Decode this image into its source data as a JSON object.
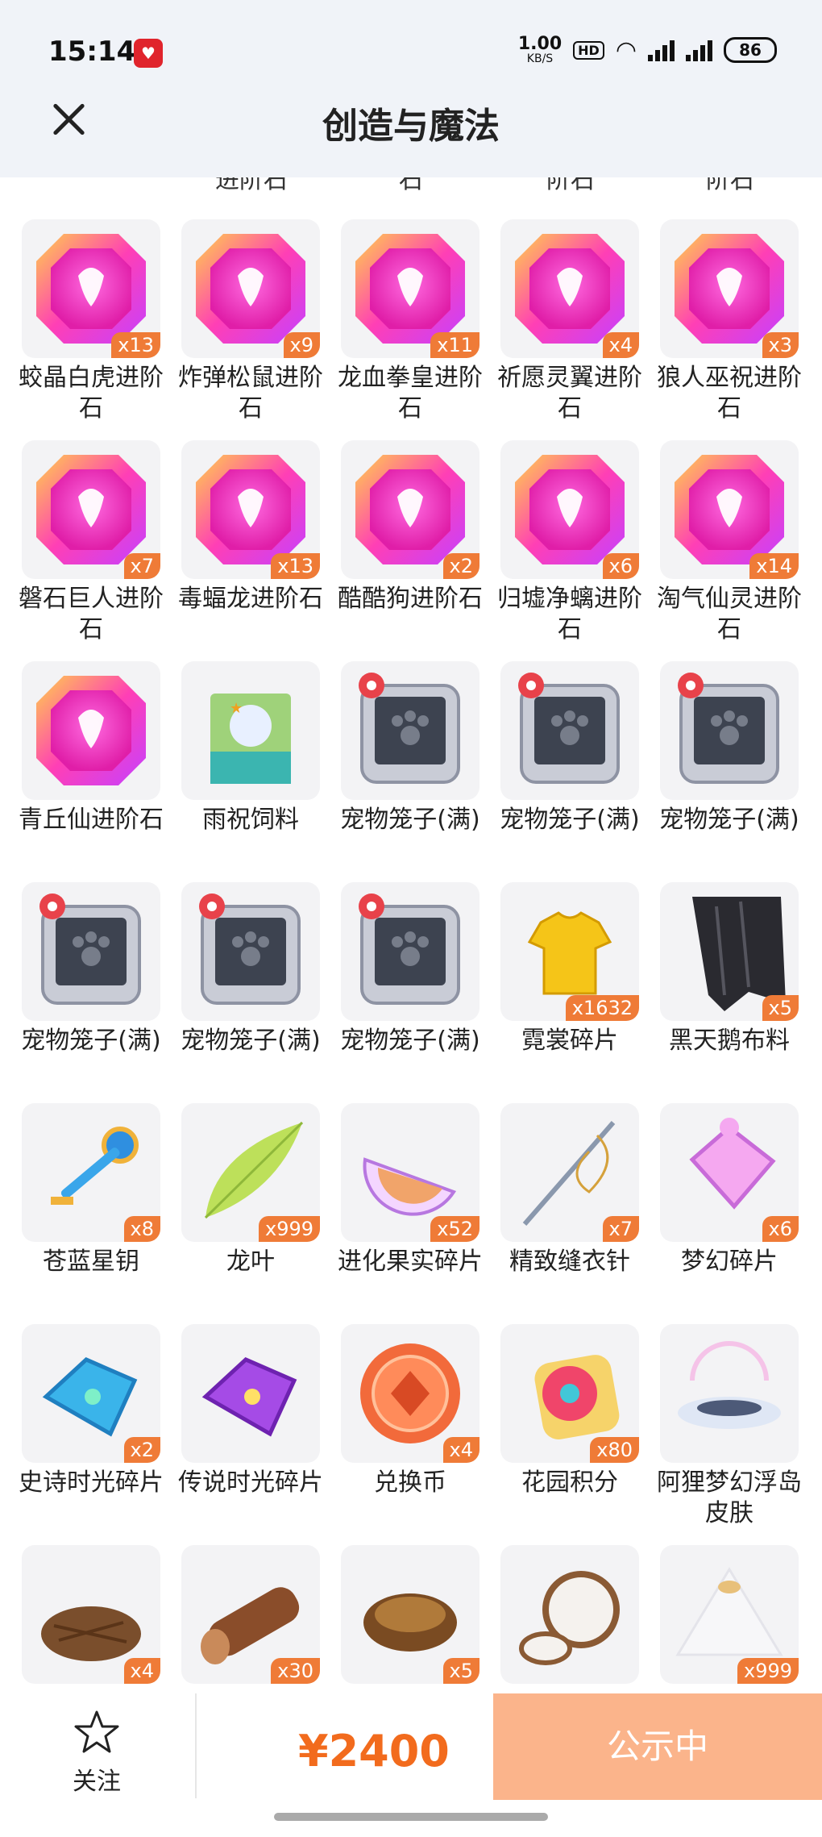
{
  "status_bar": {
    "time": "15:14",
    "net_speed_value": "1.00",
    "net_speed_unit": "KB/S",
    "battery": "86"
  },
  "header": {
    "title": "创造与魔法"
  },
  "prev_row_tail": [
    "进阶石",
    "石",
    "阶石",
    "阶石"
  ],
  "items": [
    {
      "name": "蛟晶白虎进阶石",
      "qty": "x13",
      "icon": "gem-icon"
    },
    {
      "name": "炸弹松鼠进阶石",
      "qty": "x9",
      "icon": "gem-icon"
    },
    {
      "name": "龙血拳皇进阶石",
      "qty": "x11",
      "icon": "gem-icon"
    },
    {
      "name": "祈愿灵翼进阶石",
      "qty": "x4",
      "icon": "gem-icon"
    },
    {
      "name": "狼人巫祝进阶石",
      "qty": "x3",
      "icon": "gem-icon"
    },
    {
      "name": "磐石巨人进阶石",
      "qty": "x7",
      "icon": "gem-icon"
    },
    {
      "name": "毒蝠龙进阶石",
      "qty": "x13",
      "icon": "gem-icon"
    },
    {
      "name": "酷酷狗进阶石",
      "qty": "x2",
      "icon": "gem-icon"
    },
    {
      "name": "归墟净螭进阶石",
      "qty": "x6",
      "icon": "gem-icon"
    },
    {
      "name": "淘气仙灵进阶石",
      "qty": "x14",
      "icon": "gem-icon"
    },
    {
      "name": "青丘仙进阶石",
      "qty": "",
      "icon": "gem-icon"
    },
    {
      "name": "雨祝饲料",
      "qty": "",
      "icon": "feed-bag-icon"
    },
    {
      "name": "宠物笼子(满)",
      "qty": "",
      "icon": "pet-cage-icon"
    },
    {
      "name": "宠物笼子(满)",
      "qty": "",
      "icon": "pet-cage-icon"
    },
    {
      "name": "宠物笼子(满)",
      "qty": "",
      "icon": "pet-cage-icon"
    },
    {
      "name": "宠物笼子(满)",
      "qty": "",
      "icon": "pet-cage-icon"
    },
    {
      "name": "宠物笼子(满)",
      "qty": "",
      "icon": "pet-cage-icon"
    },
    {
      "name": "宠物笼子(满)",
      "qty": "",
      "icon": "pet-cage-icon"
    },
    {
      "name": "霓裳碎片",
      "qty": "x1632",
      "icon": "shirt-icon"
    },
    {
      "name": "黑天鹅布料",
      "qty": "x5",
      "icon": "black-cloth-icon"
    },
    {
      "name": "苍蓝星钥",
      "qty": "x8",
      "icon": "key-icon"
    },
    {
      "name": "龙叶",
      "qty": "x999",
      "icon": "leaf-icon"
    },
    {
      "name": "进化果实碎片",
      "qty": "x52",
      "icon": "fruit-slice-icon"
    },
    {
      "name": "精致缝衣针",
      "qty": "x7",
      "icon": "needle-icon"
    },
    {
      "name": "梦幻碎片",
      "qty": "x6",
      "icon": "puzzle-icon"
    },
    {
      "name": "史诗时光碎片",
      "qty": "x2",
      "icon": "blue-puzzle-icon"
    },
    {
      "name": "传说时光碎片",
      "qty": "",
      "icon": "purple-puzzle-icon"
    },
    {
      "name": "兑换币",
      "qty": "x4",
      "icon": "coin-icon"
    },
    {
      "name": "花园积分",
      "qty": "x80",
      "icon": "flower-icon"
    },
    {
      "name": "阿狸梦幻浮岛皮肤",
      "qty": "",
      "icon": "island-icon"
    },
    {
      "name": "",
      "qty": "x4",
      "icon": "pinecone-icon"
    },
    {
      "name": "",
      "qty": "x30",
      "icon": "wood-log-icon"
    },
    {
      "name": "",
      "qty": "x5",
      "icon": "resin-icon"
    },
    {
      "name": "",
      "qty": "",
      "icon": "coconut-icon"
    },
    {
      "name": "",
      "qty": "x999",
      "icon": "crystal-icon"
    }
  ],
  "bottom": {
    "follow_label": "关注",
    "price": "¥2400",
    "status_label": "公示中"
  },
  "colors": {
    "accent": "#ef7b37",
    "price": "#f26b1d",
    "status_button": "#fbb48b",
    "header_bg": "#f0f3f8"
  }
}
